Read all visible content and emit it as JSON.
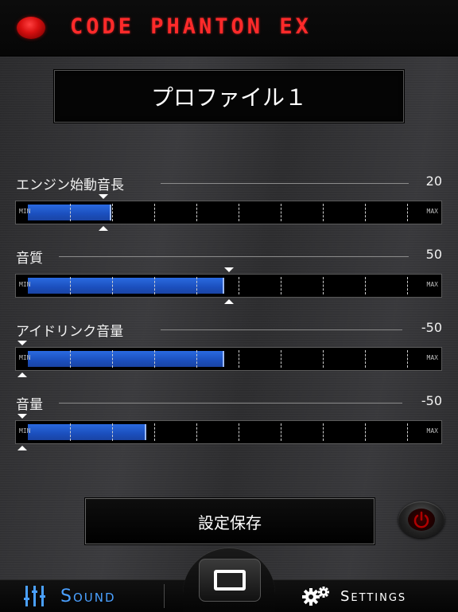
{
  "header": {
    "title": "CODE PHANTON EX"
  },
  "profile": {
    "name": "プロファイル１"
  },
  "settings": [
    {
      "label": "エンジン始動音長",
      "value": "20",
      "fill": 0.21,
      "min_label": "MIN",
      "max_label": "MAX"
    },
    {
      "label": "音質",
      "value": "50",
      "fill": 0.5,
      "min_label": "MIN",
      "max_label": "MAX"
    },
    {
      "label": "アイドリンク音量",
      "value": "-50",
      "fill": 0.5,
      "min_label": "MIN",
      "max_label": "MAX"
    },
    {
      "label": "音量",
      "value": "-50",
      "fill": 0.3,
      "min_label": "MIN",
      "max_label": "MAX"
    }
  ],
  "save": {
    "label": "設定保存"
  },
  "tabs": {
    "sound": "Sound",
    "settings": "Settings"
  },
  "colors": {
    "accent_red": "#ff2a2a",
    "fill_blue": "#1b4fbd",
    "tab_active": "#4aa0ff"
  }
}
